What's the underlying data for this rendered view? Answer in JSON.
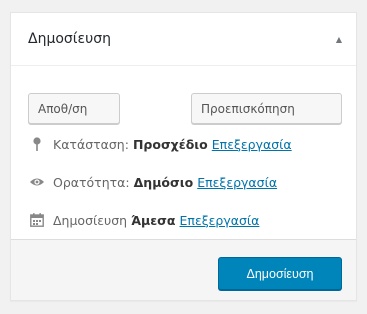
{
  "panel": {
    "title": "Δημοσίευση",
    "toggle_icon": "caret-up-icon"
  },
  "buttons": {
    "save": "Αποθ/ση",
    "preview": "Προεπισκόπηση",
    "publish": "Δημοσίευση"
  },
  "status": {
    "icon": "pin-icon",
    "label": "Κατάσταση:",
    "value": "Προσχέδιο",
    "edit": "Επεξεργασία"
  },
  "visibility": {
    "icon": "eye-icon",
    "label": "Ορατότητα:",
    "value": "Δημόσιο",
    "edit": "Επεξεργασία"
  },
  "schedule": {
    "icon": "calendar-icon",
    "label": "Δημοσίευση",
    "value": "Άμεσα",
    "edit": "Επεξεργασία"
  },
  "colors": {
    "primary": "#0085ba",
    "link": "#0073aa"
  }
}
